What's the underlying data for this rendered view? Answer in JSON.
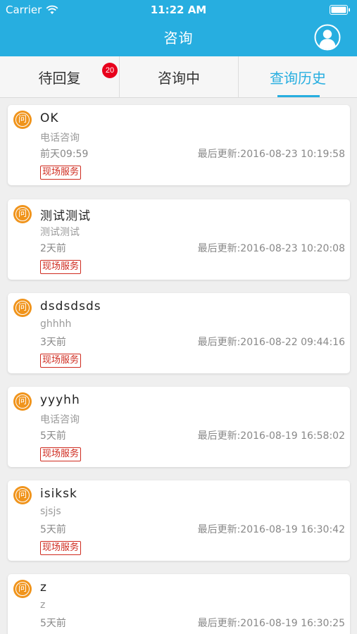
{
  "status_bar": {
    "carrier": "Carrier",
    "time": "11:22 AM"
  },
  "header": {
    "title": "咨询"
  },
  "tabs": [
    {
      "label": "待回复",
      "badge": "20"
    },
    {
      "label": "咨询中"
    },
    {
      "label": "查询历史"
    }
  ],
  "icons": {
    "question": "问"
  },
  "cards": [
    {
      "title": "OK",
      "subtitle": "电话咨询",
      "time": "前天09:59",
      "updated": "最后更新:2016-08-23 10:19:58",
      "tag": "现场服务"
    },
    {
      "title": "测试测试",
      "subtitle": "测试测试",
      "time": "2天前",
      "updated": "最后更新:2016-08-23 10:20:08",
      "tag": "现场服务"
    },
    {
      "title": "dsdsdsds",
      "subtitle": "ghhhh",
      "time": "3天前",
      "updated": "最后更新:2016-08-22 09:44:16",
      "tag": "现场服务"
    },
    {
      "title": "yyyhh",
      "subtitle": "电话咨询",
      "time": "5天前",
      "updated": "最后更新:2016-08-19 16:58:02",
      "tag": "现场服务"
    },
    {
      "title": "isiksk",
      "subtitle": "sjsjs",
      "time": "5天前",
      "updated": "最后更新:2016-08-19 16:30:42",
      "tag": "现场服务"
    },
    {
      "title": "z",
      "subtitle": "z",
      "time": "5天前",
      "updated": "最后更新:2016-08-19 16:30:25",
      "tag": ""
    }
  ],
  "colors": {
    "primary": "#27aee0",
    "badge": "#e8001c",
    "icon_orange": "#f0941c",
    "tag_red": "#cf2b1f"
  }
}
